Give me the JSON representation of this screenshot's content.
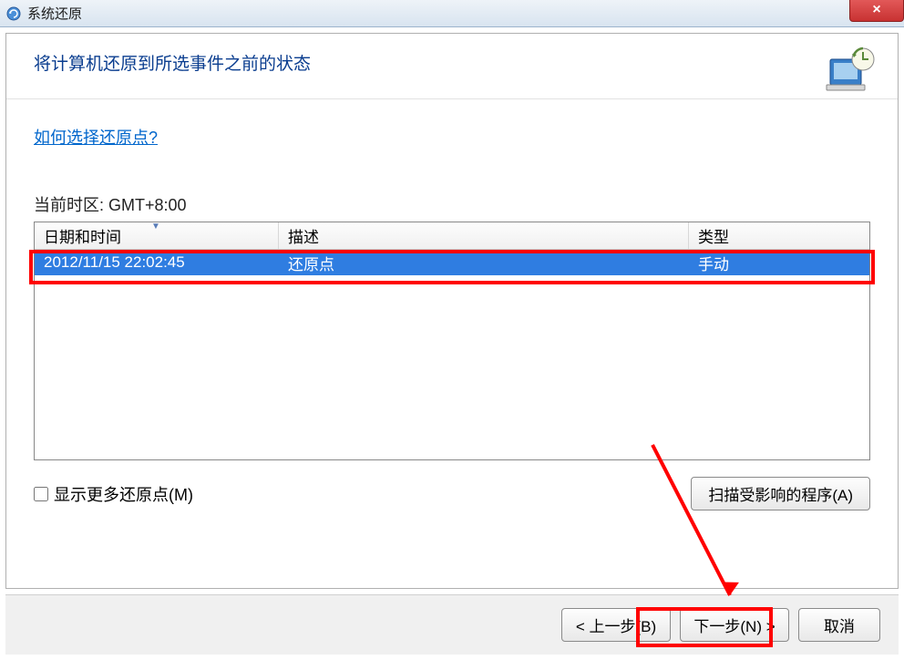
{
  "window": {
    "title": "系统还原",
    "close_label": "×"
  },
  "header": {
    "title": "将计算机还原到所选事件之前的状态"
  },
  "help_link": "如何选择还原点?",
  "timezone_label": "当前时区: GMT+8:00",
  "table": {
    "columns": {
      "date": "日期和时间",
      "desc": "描述",
      "type": "类型"
    },
    "rows": [
      {
        "date": "2012/11/15 22:02:45",
        "desc": "还原点",
        "type": "手动"
      }
    ]
  },
  "show_more_checkbox": "显示更多还原点(M)",
  "scan_button": "扫描受影响的程序(A)",
  "buttons": {
    "back": "< 上一步(B)",
    "next": "下一步(N) >",
    "cancel": "取消"
  }
}
